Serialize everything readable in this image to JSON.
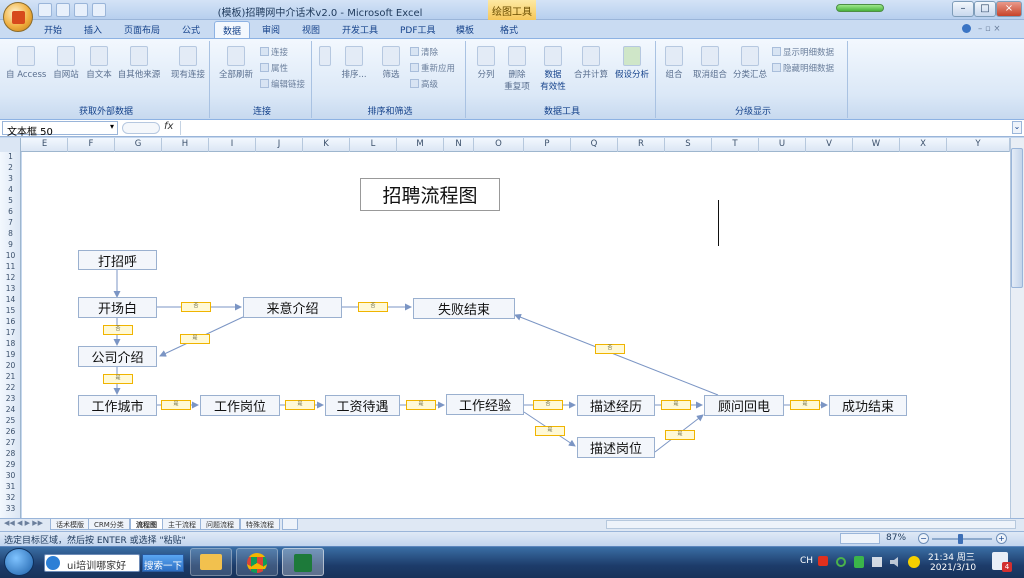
{
  "window": {
    "title": "(模板)招聘网中介话术v2.0 - Microsoft Excel",
    "context_tool": "绘图工具",
    "controls": [
      "–",
      "□",
      "×"
    ]
  },
  "ribbon": {
    "tabs": [
      "开始",
      "插入",
      "页面布局",
      "公式",
      "数据",
      "审阅",
      "视图",
      "开发工具",
      "PDF工具",
      "模板",
      "格式"
    ],
    "active_tab": "数据",
    "groups": {
      "external": {
        "label": "获取外部数据",
        "buttons": [
          "自 Access",
          "自网站",
          "自文本",
          "自其他来源",
          "现有连接"
        ]
      },
      "connections": {
        "label": "连接",
        "big": "全部刷新",
        "small": [
          "连接",
          "属性",
          "编辑链接"
        ]
      },
      "sort_filter": {
        "label": "排序和筛选",
        "big": [
          "排序...",
          "筛选"
        ],
        "small": [
          "清除",
          "重新应用",
          "高级"
        ]
      },
      "data_tools": {
        "label": "数据工具",
        "buttons": [
          "分列",
          "删除\n重复项",
          "数据\n有效性",
          "合并计算",
          "假设分析"
        ]
      },
      "outline": {
        "label": "分级显示",
        "buttons": [
          "组合",
          "取消组合",
          "分类汇总"
        ],
        "small": [
          "显示明细数据",
          "隐藏明细数据"
        ]
      }
    }
  },
  "formula_bar": {
    "name_box": "文本框 50",
    "fx": "fx",
    "content": ""
  },
  "grid": {
    "columns": [
      "E",
      "F",
      "G",
      "H",
      "I",
      "J",
      "K",
      "L",
      "M",
      "N",
      "O",
      "P",
      "Q",
      "R",
      "S",
      "T",
      "U",
      "V",
      "W",
      "X",
      "Y"
    ],
    "rows": [
      "1",
      "2",
      "3",
      "4",
      "5",
      "6",
      "7",
      "8",
      "9",
      "10",
      "11",
      "12",
      "13",
      "14",
      "15",
      "16",
      "17",
      "18",
      "19",
      "20",
      "21",
      "22",
      "23",
      "24",
      "25",
      "26",
      "27",
      "28",
      "29",
      "30",
      "31",
      "32",
      "33"
    ]
  },
  "flowchart": {
    "title": "招聘流程图",
    "nodes": {
      "greet": "打招呼",
      "opening": "开场白",
      "intent": "来意介绍",
      "fail": "失败结束",
      "company": "公司介绍",
      "city": "工作城市",
      "position": "工作岗位",
      "salary": "工资待遇",
      "experience": "工作经验",
      "describe_exp": "描述经历",
      "describe_pos": "描述岗位",
      "callback": "顾问回电",
      "success": "成功结束"
    }
  },
  "sheets": {
    "tabs": [
      "话术模版",
      "CRM分类",
      "流程图",
      "主干流程",
      "问题流程",
      "特殊流程"
    ],
    "active": "流程图"
  },
  "status": {
    "message": "选定目标区域，然后按 ENTER 或选择 \"粘贴\"",
    "zoom": "87%"
  },
  "taskbar": {
    "search_text": "ui培训哪家好",
    "search_button": "搜索一下",
    "time": "21:34 周三",
    "date": "2021/3/10",
    "notification_count": "4",
    "ime": "CH"
  },
  "colors": {
    "ribbon_bg": "#dbe8f7",
    "accent": "#15428b",
    "connector_label": "#f0b400",
    "taskbar": "#1d3c6a"
  }
}
